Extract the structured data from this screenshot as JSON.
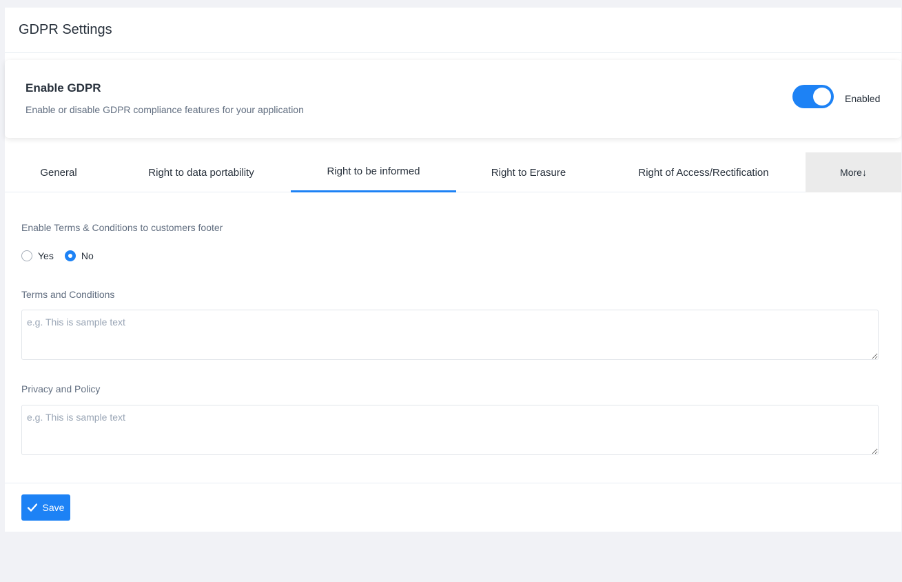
{
  "header": {
    "title": "GDPR Settings"
  },
  "gdpr": {
    "title": "Enable GDPR",
    "description": "Enable or disable GDPR compliance features for your application",
    "toggle_state": "Enabled"
  },
  "tabs": [
    {
      "label": "General"
    },
    {
      "label": "Right to data portability"
    },
    {
      "label": "Right to be informed",
      "active": true
    },
    {
      "label": "Right to Erasure"
    },
    {
      "label": "Right of Access/Rectification"
    },
    {
      "label": "More↓"
    }
  ],
  "form": {
    "terms_footer_label": "Enable Terms & Conditions to customers footer",
    "radio_yes": "Yes",
    "radio_no": "No",
    "selected": "No",
    "terms_label": "Terms and Conditions",
    "terms_placeholder": "e.g. This is sample text",
    "terms_value": "",
    "privacy_label": "Privacy and Policy",
    "privacy_placeholder": "e.g. This is sample text",
    "privacy_value": ""
  },
  "actions": {
    "save_label": "Save"
  },
  "colors": {
    "accent": "#1d82f5",
    "background": "#f1f2f6"
  },
  "icons": {
    "save": "check-icon"
  }
}
